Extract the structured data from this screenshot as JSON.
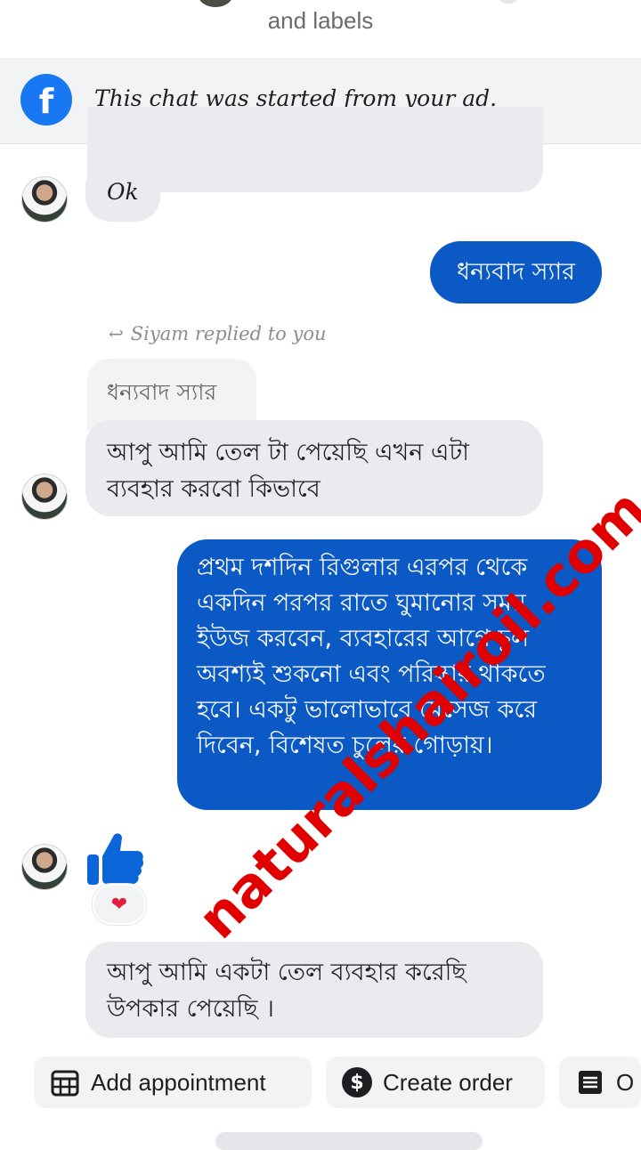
{
  "header": {
    "subtitle": "and labels"
  },
  "ad_banner": {
    "icon": "facebook-icon",
    "text": "This chat was started from your ad."
  },
  "messages": {
    "ok": "Ok",
    "thanks_sent": "ধন্যবাদ স্যার",
    "reply_notice": "Siyam replied to you",
    "quoted_text": "ধন্যবাদ স্যার",
    "reply_text": "আপু আমি তেল টা পেয়েছি এখন এটা ব্যবহার করবো কিভাবে",
    "instructions": "প্রথম দশদিন রিগুলার এরপর থেকে একদিন পরপর রাতে ঘুমানোর সময় ইউজ করবেন, ব্যবহারের আগে চুল অবশ্যই শুকনো এবং পরিষ্কার থাকতে হবে। একটু ভালোভাবে মেসেজ করে দিবেন, বিশেষত চুলের গোড়ায়।",
    "last_text": "আপু আমি একটা তেল ব্যবহার করেছি উপকার পেয়েছি ।",
    "like_icon": "thumbs-up-icon",
    "reaction_icon": "heart-icon"
  },
  "watermark": "naturalshairoil.com",
  "actions": {
    "add_appointment": "Add appointment",
    "create_order": "Create order",
    "more": "O"
  },
  "colors": {
    "outgoing_bubble": "#0a59c5",
    "incoming_bubble": "#eaebee",
    "watermark": "#e00000",
    "facebook": "#1877f2"
  }
}
